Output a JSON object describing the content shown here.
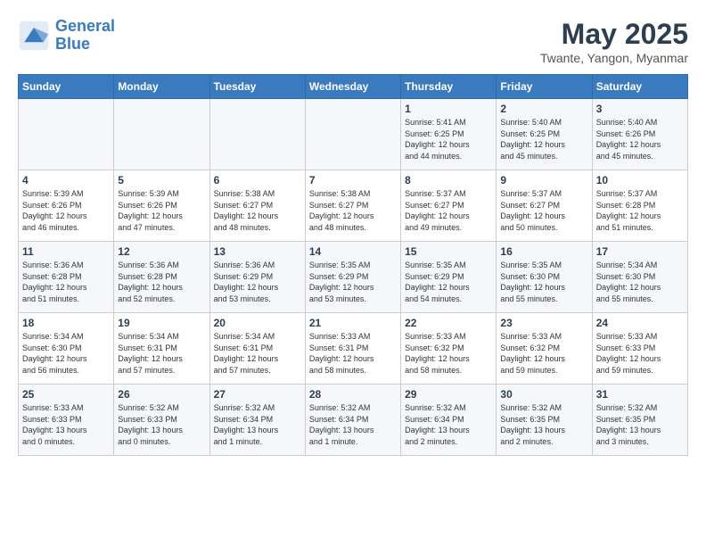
{
  "logo": {
    "line1": "General",
    "line2": "Blue"
  },
  "title": "May 2025",
  "subtitle": "Twante, Yangon, Myanmar",
  "headers": [
    "Sunday",
    "Monday",
    "Tuesday",
    "Wednesday",
    "Thursday",
    "Friday",
    "Saturday"
  ],
  "weeks": [
    [
      {
        "day": "",
        "detail": ""
      },
      {
        "day": "",
        "detail": ""
      },
      {
        "day": "",
        "detail": ""
      },
      {
        "day": "",
        "detail": ""
      },
      {
        "day": "1",
        "detail": "Sunrise: 5:41 AM\nSunset: 6:25 PM\nDaylight: 12 hours\nand 44 minutes."
      },
      {
        "day": "2",
        "detail": "Sunrise: 5:40 AM\nSunset: 6:25 PM\nDaylight: 12 hours\nand 45 minutes."
      },
      {
        "day": "3",
        "detail": "Sunrise: 5:40 AM\nSunset: 6:26 PM\nDaylight: 12 hours\nand 45 minutes."
      }
    ],
    [
      {
        "day": "4",
        "detail": "Sunrise: 5:39 AM\nSunset: 6:26 PM\nDaylight: 12 hours\nand 46 minutes."
      },
      {
        "day": "5",
        "detail": "Sunrise: 5:39 AM\nSunset: 6:26 PM\nDaylight: 12 hours\nand 47 minutes."
      },
      {
        "day": "6",
        "detail": "Sunrise: 5:38 AM\nSunset: 6:27 PM\nDaylight: 12 hours\nand 48 minutes."
      },
      {
        "day": "7",
        "detail": "Sunrise: 5:38 AM\nSunset: 6:27 PM\nDaylight: 12 hours\nand 48 minutes."
      },
      {
        "day": "8",
        "detail": "Sunrise: 5:37 AM\nSunset: 6:27 PM\nDaylight: 12 hours\nand 49 minutes."
      },
      {
        "day": "9",
        "detail": "Sunrise: 5:37 AM\nSunset: 6:27 PM\nDaylight: 12 hours\nand 50 minutes."
      },
      {
        "day": "10",
        "detail": "Sunrise: 5:37 AM\nSunset: 6:28 PM\nDaylight: 12 hours\nand 51 minutes."
      }
    ],
    [
      {
        "day": "11",
        "detail": "Sunrise: 5:36 AM\nSunset: 6:28 PM\nDaylight: 12 hours\nand 51 minutes."
      },
      {
        "day": "12",
        "detail": "Sunrise: 5:36 AM\nSunset: 6:28 PM\nDaylight: 12 hours\nand 52 minutes."
      },
      {
        "day": "13",
        "detail": "Sunrise: 5:36 AM\nSunset: 6:29 PM\nDaylight: 12 hours\nand 53 minutes."
      },
      {
        "day": "14",
        "detail": "Sunrise: 5:35 AM\nSunset: 6:29 PM\nDaylight: 12 hours\nand 53 minutes."
      },
      {
        "day": "15",
        "detail": "Sunrise: 5:35 AM\nSunset: 6:29 PM\nDaylight: 12 hours\nand 54 minutes."
      },
      {
        "day": "16",
        "detail": "Sunrise: 5:35 AM\nSunset: 6:30 PM\nDaylight: 12 hours\nand 55 minutes."
      },
      {
        "day": "17",
        "detail": "Sunrise: 5:34 AM\nSunset: 6:30 PM\nDaylight: 12 hours\nand 55 minutes."
      }
    ],
    [
      {
        "day": "18",
        "detail": "Sunrise: 5:34 AM\nSunset: 6:30 PM\nDaylight: 12 hours\nand 56 minutes."
      },
      {
        "day": "19",
        "detail": "Sunrise: 5:34 AM\nSunset: 6:31 PM\nDaylight: 12 hours\nand 57 minutes."
      },
      {
        "day": "20",
        "detail": "Sunrise: 5:34 AM\nSunset: 6:31 PM\nDaylight: 12 hours\nand 57 minutes."
      },
      {
        "day": "21",
        "detail": "Sunrise: 5:33 AM\nSunset: 6:31 PM\nDaylight: 12 hours\nand 58 minutes."
      },
      {
        "day": "22",
        "detail": "Sunrise: 5:33 AM\nSunset: 6:32 PM\nDaylight: 12 hours\nand 58 minutes."
      },
      {
        "day": "23",
        "detail": "Sunrise: 5:33 AM\nSunset: 6:32 PM\nDaylight: 12 hours\nand 59 minutes."
      },
      {
        "day": "24",
        "detail": "Sunrise: 5:33 AM\nSunset: 6:33 PM\nDaylight: 12 hours\nand 59 minutes."
      }
    ],
    [
      {
        "day": "25",
        "detail": "Sunrise: 5:33 AM\nSunset: 6:33 PM\nDaylight: 13 hours\nand 0 minutes."
      },
      {
        "day": "26",
        "detail": "Sunrise: 5:32 AM\nSunset: 6:33 PM\nDaylight: 13 hours\nand 0 minutes."
      },
      {
        "day": "27",
        "detail": "Sunrise: 5:32 AM\nSunset: 6:34 PM\nDaylight: 13 hours\nand 1 minute."
      },
      {
        "day": "28",
        "detail": "Sunrise: 5:32 AM\nSunset: 6:34 PM\nDaylight: 13 hours\nand 1 minute."
      },
      {
        "day": "29",
        "detail": "Sunrise: 5:32 AM\nSunset: 6:34 PM\nDaylight: 13 hours\nand 2 minutes."
      },
      {
        "day": "30",
        "detail": "Sunrise: 5:32 AM\nSunset: 6:35 PM\nDaylight: 13 hours\nand 2 minutes."
      },
      {
        "day": "31",
        "detail": "Sunrise: 5:32 AM\nSunset: 6:35 PM\nDaylight: 13 hours\nand 3 minutes."
      }
    ]
  ]
}
